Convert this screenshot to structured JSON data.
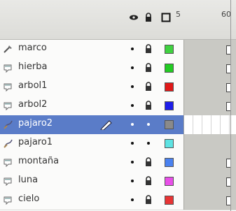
{
  "header": {
    "frame_numbers": [
      "5",
      "60"
    ],
    "icons": [
      "eye-icon",
      "lock-icon",
      "outline-icon"
    ]
  },
  "layers": [
    {
      "name": "marco",
      "icon": "guide-layer-icon",
      "selected": false,
      "lock": "locked",
      "color": "#3fd23f",
      "keyframe": true
    },
    {
      "name": "hierba",
      "icon": "layer-icon",
      "selected": false,
      "lock": "locked",
      "color": "#22cc22",
      "keyframe": true
    },
    {
      "name": "arbol1",
      "icon": "layer-icon",
      "selected": false,
      "lock": "locked",
      "color": "#e01818",
      "keyframe": true
    },
    {
      "name": "arbol2",
      "icon": "layer-icon",
      "selected": false,
      "lock": "locked",
      "color": "#1d1dea",
      "keyframe": true
    },
    {
      "name": "pajaro2",
      "icon": "motion-guide-icon",
      "selected": true,
      "lock": "unlocked",
      "color": "#8a8a8a",
      "keyframe": false
    },
    {
      "name": "pajaro1",
      "icon": "motion-guide-icon",
      "selected": false,
      "lock": "unlocked",
      "color": "#5ee3e3",
      "keyframe": false
    },
    {
      "name": "montaña",
      "icon": "layer-icon",
      "selected": false,
      "lock": "locked",
      "color": "#4a82f0",
      "keyframe": true
    },
    {
      "name": "luna",
      "icon": "layer-icon",
      "selected": false,
      "lock": "locked",
      "color": "#e84fe8",
      "keyframe": true
    },
    {
      "name": "cielo",
      "icon": "layer-icon",
      "selected": false,
      "lock": "locked",
      "color": "#e83434",
      "keyframe": true
    }
  ],
  "selected_layer_tool": "pencil-icon"
}
